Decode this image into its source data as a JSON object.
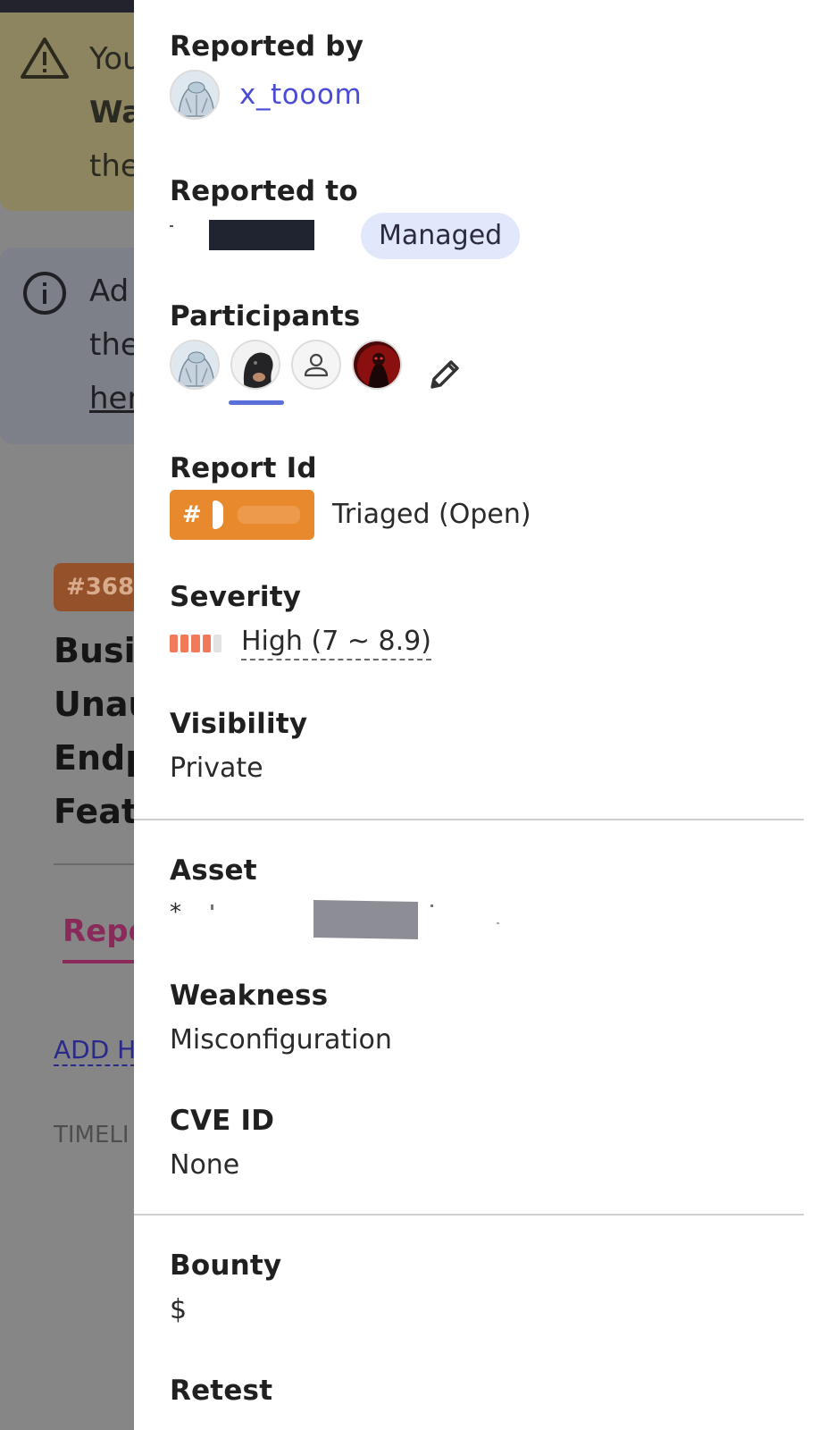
{
  "background_page": {
    "warning_lines": [
      "You",
      "Wa",
      "the"
    ],
    "info_lines": [
      "Ad",
      "the",
      "her"
    ],
    "report_badge": "#368",
    "title_lines": [
      "Busi",
      "Unau",
      "Endp",
      "Feat"
    ],
    "tab_label": "Repo",
    "add_link": "ADD H",
    "timeline_label": "TIMELI"
  },
  "drawer": {
    "reported_by": {
      "label": "Reported by",
      "username": "x_tooom"
    },
    "reported_to": {
      "label": "Reported to",
      "pill": "Managed"
    },
    "participants": {
      "label": "Participants",
      "icons": [
        "avatar-1",
        "avatar-2",
        "default-user-icon",
        "avatar-4",
        "pencil-icon"
      ]
    },
    "report_id": {
      "label": "Report Id",
      "badge_prefix": "#",
      "status": "Triaged (Open)"
    },
    "severity": {
      "label": "Severity",
      "value": "High (7 ~ 8.9)",
      "level_filled": 4,
      "level_total": 5
    },
    "visibility": {
      "label": "Visibility",
      "value": "Private"
    },
    "asset": {
      "label": "Asset",
      "prefix": "*"
    },
    "weakness": {
      "label": "Weakness",
      "value": "Misconfiguration"
    },
    "cve": {
      "label": "CVE ID",
      "value": "None"
    },
    "bounty": {
      "label": "Bounty",
      "value": "$"
    },
    "retest": {
      "label": "Retest"
    }
  },
  "colors": {
    "link": "#4b4bd6",
    "accent_orange": "#e8892d",
    "severity_high": "#f07a5a",
    "pill_bg": "#e2e8fb"
  }
}
